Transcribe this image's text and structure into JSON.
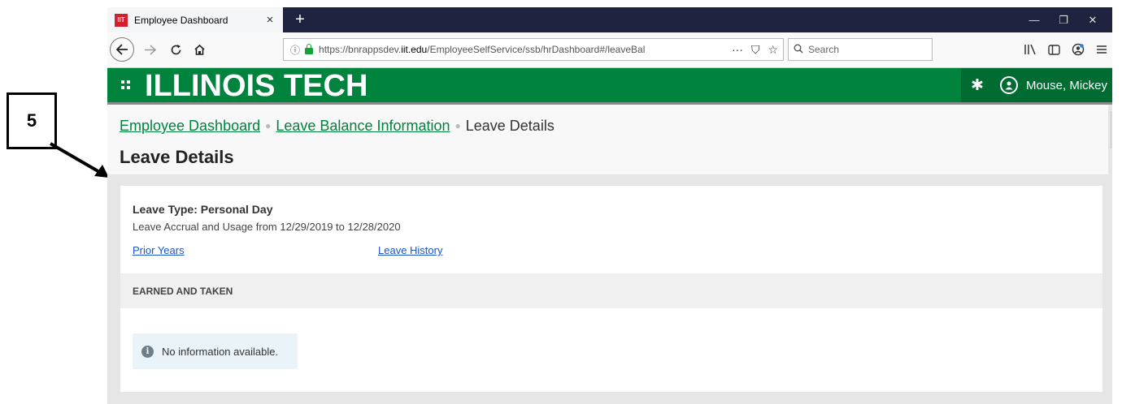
{
  "annotation": {
    "number": "5"
  },
  "browser": {
    "tab": {
      "favicon_text": "IIT",
      "title": "Employee Dashboard",
      "close": "×"
    },
    "new_tab": "+",
    "window_controls": {
      "minimize": "—",
      "restore": "❐",
      "close": "✕"
    },
    "url": {
      "prefix": "https://bnrappsdev.",
      "domain": "iit.edu",
      "path": "/EmployeeSelfService/ssb/hrDashboard#/leaveBal"
    },
    "search": {
      "placeholder": "Search"
    },
    "url_actions": {
      "more": "···",
      "pocket": "⛉",
      "bookmark": "☆"
    },
    "toolbar_icons": [
      "library-icon",
      "sidebar-icon",
      "account-icon",
      "menu-icon"
    ]
  },
  "header": {
    "logo": "ILLINOIS TECH",
    "user_name": "Mouse, Mickey",
    "brand_color": "#00843d"
  },
  "breadcrumb": {
    "items": [
      "Employee Dashboard",
      "Leave Balance Information",
      "Leave Details"
    ]
  },
  "page": {
    "title": "Leave Details",
    "leave_type": "Leave Type: Personal Day",
    "accrual_text": "Leave Accrual and Usage from 12/29/2019 to 12/28/2020",
    "prior_years_link": "Prior Years",
    "leave_history_link": "Leave History",
    "section_title": "EARNED AND TAKEN",
    "notice": "No information available."
  }
}
